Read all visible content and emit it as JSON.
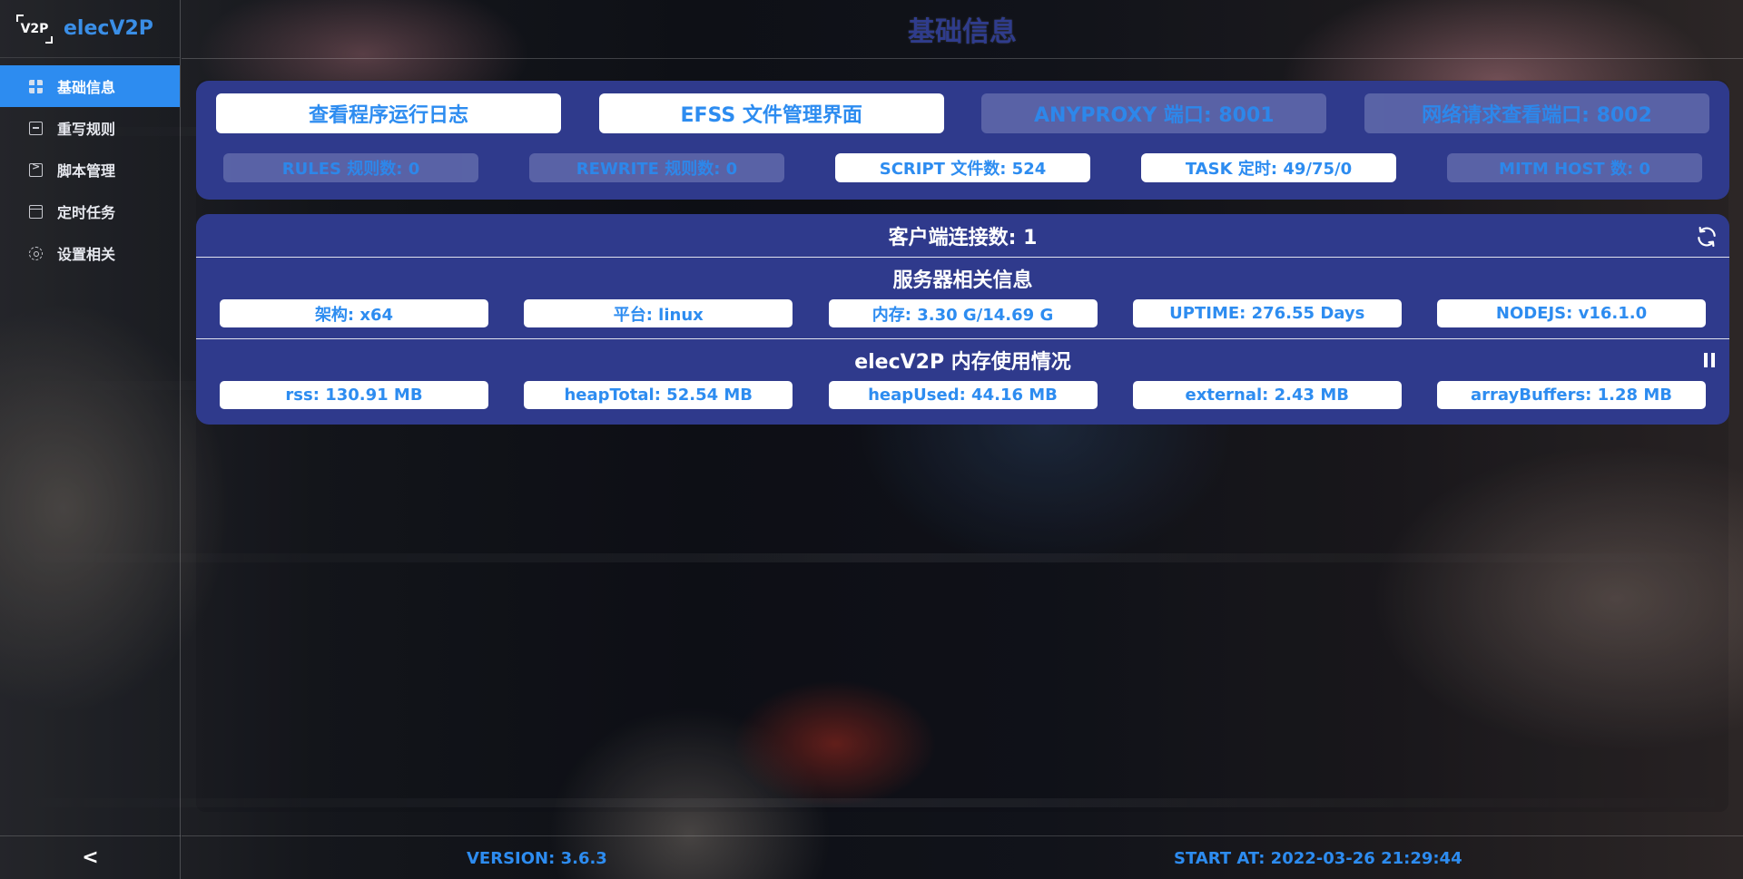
{
  "app": {
    "logo_text": "V2P",
    "name": "elecV2P"
  },
  "sidebar": {
    "items": [
      {
        "label": "基础信息",
        "icon": "grid-icon",
        "active": true
      },
      {
        "label": "重写规则",
        "icon": "document-icon",
        "active": false
      },
      {
        "label": "脚本管理",
        "icon": "terminal-icon",
        "active": false
      },
      {
        "label": "定时任务",
        "icon": "calendar-icon",
        "active": false
      },
      {
        "label": "设置相关",
        "icon": "gear-icon",
        "active": false
      }
    ],
    "collapse_label": "<"
  },
  "header": {
    "title": "基础信息"
  },
  "actions": {
    "log_button": "查看程序运行日志",
    "efss_button": "EFSS 文件管理界面",
    "anyproxy_port": "ANYPROXY 端口: 8001",
    "web_port": "网络请求查看端口: 8002"
  },
  "stats": {
    "rules": "RULES 规则数: 0",
    "rewrite": "REWRITE 规则数: 0",
    "script": "SCRIPT 文件数: 524",
    "task": "TASK 定时: 49/75/0",
    "mitm": "MITM HOST 数: 0"
  },
  "client": {
    "title": "客户端连接数: 1"
  },
  "server": {
    "title": "服务器相关信息",
    "items": [
      "架构: x64",
      "平台: linux",
      "内存: 3.30 G/14.69 G",
      "UPTIME: 276.55 Days",
      "NODEJS: v16.1.0"
    ]
  },
  "memory": {
    "title": "elecV2P 内存使用情况",
    "items": [
      "rss: 130.91 MB",
      "heapTotal: 52.54 MB",
      "heapUsed: 44.16 MB",
      "external: 2.43 MB",
      "arrayBuffers: 1.28 MB"
    ]
  },
  "footer": {
    "version": "VERSION: 3.6.3",
    "start_at": "START AT: 2022-03-26 21:29:44"
  },
  "colors": {
    "accent": "#2d8cf0",
    "card": "#2f3a8c",
    "title": "#2f3c8c",
    "disabled": "#5c65a8"
  }
}
